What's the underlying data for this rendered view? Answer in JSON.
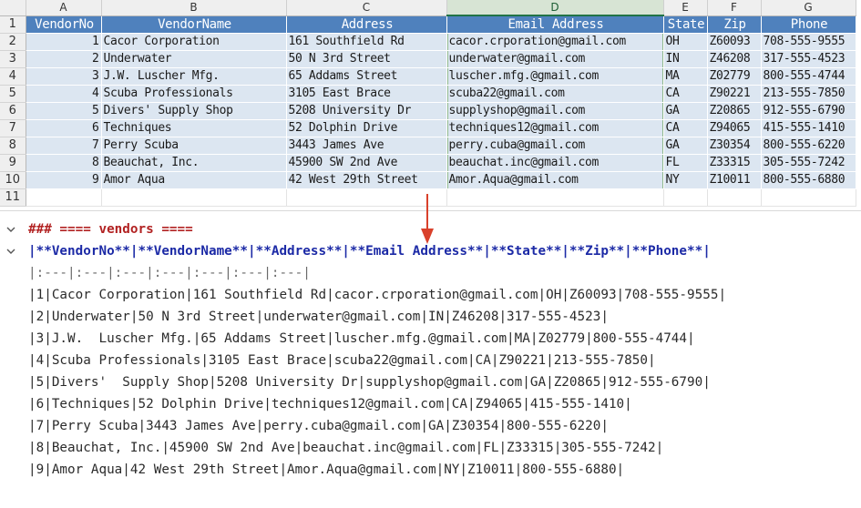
{
  "spreadsheet": {
    "column_letters": [
      "A",
      "B",
      "C",
      "D",
      "E",
      "F",
      "G"
    ],
    "row_numbers": [
      "1",
      "2",
      "3",
      "4",
      "5",
      "6",
      "7",
      "8",
      "9",
      "10",
      "11"
    ],
    "headers": [
      "VendorNo",
      "VendorName",
      "Address",
      "Email Address",
      "State",
      "Zip",
      "Phone"
    ],
    "rows": [
      [
        "1",
        "Cacor Corporation",
        "161 Southfield Rd",
        "cacor.crporation@gmail.com",
        "OH",
        "Z60093",
        "708-555-9555"
      ],
      [
        "2",
        "Underwater",
        "50 N 3rd Street",
        "underwater@gmail.com",
        "IN",
        "Z46208",
        "317-555-4523"
      ],
      [
        "3",
        "J.W.  Luscher Mfg.",
        "65 Addams Street",
        "luscher.mfg.@gmail.com",
        "MA",
        "Z02779",
        "800-555-4744"
      ],
      [
        "4",
        "Scuba Professionals",
        "3105 East Brace",
        "scuba22@gmail.com",
        "CA",
        "Z90221",
        "213-555-7850"
      ],
      [
        "5",
        "Divers'  Supply Shop",
        "5208 University Dr",
        "supplyshop@gmail.com",
        "GA",
        "Z20865",
        "912-555-6790"
      ],
      [
        "6",
        "Techniques",
        "52 Dolphin Drive",
        "techniques12@gmail.com",
        "CA",
        "Z94065",
        "415-555-1410"
      ],
      [
        "7",
        "Perry Scuba",
        "3443 James Ave",
        "perry.cuba@gmail.com",
        "GA",
        "Z30354",
        "800-555-6220"
      ],
      [
        "8",
        "Beauchat, Inc.",
        "45900 SW 2nd Ave",
        "beauchat.inc@gmail.com",
        "FL",
        "Z33315",
        "305-555-7242"
      ],
      [
        "9",
        "Amor Aqua",
        "42 West 29th Street",
        "Amor.Aqua@gmail.com",
        "NY",
        "Z10011",
        "800-555-6880"
      ]
    ],
    "selected_column": "D"
  },
  "markdown": {
    "heading": "### ==== vendors ====",
    "table_header": "|**VendorNo**|**VendorName**|**Address**|**Email Address**|**State**|**Zip**|**Phone**|",
    "separator": "|:---|:---|:---|:---|:---|:---|:---|",
    "rows": [
      "|1|Cacor Corporation|161 Southfield Rd|cacor.crporation@gmail.com|OH|Z60093|708-555-9555|",
      "|2|Underwater|50 N 3rd Street|underwater@gmail.com|IN|Z46208|317-555-4523|",
      "|3|J.W.  Luscher Mfg.|65 Addams Street|luscher.mfg.@gmail.com|MA|Z02779|800-555-4744|",
      "|4|Scuba Professionals|3105 East Brace|scuba22@gmail.com|CA|Z90221|213-555-7850|",
      "|5|Divers'  Supply Shop|5208 University Dr|supplyshop@gmail.com|GA|Z20865|912-555-6790|",
      "|6|Techniques|52 Dolphin Drive|techniques12@gmail.com|CA|Z94065|415-555-1410|",
      "|7|Perry Scuba|3443 James Ave|perry.cuba@gmail.com|GA|Z30354|800-555-6220|",
      "|8|Beauchat, Inc.|45900 SW 2nd Ave|beauchat.inc@gmail.com|FL|Z33315|305-555-7242|",
      "|9|Amor Aqua|42 West 29th Street|Amor.Aqua@gmail.com|NY|Z10011|800-555-6880|"
    ]
  },
  "icons": {
    "fold_heading": "chevron-down-icon",
    "fold_table": "chevron-down-icon",
    "arrow": "arrow-down-icon"
  },
  "colors": {
    "header_fill": "#4f81bd",
    "band_fill": "#dce6f1",
    "heading_text": "#b22222",
    "table_header_text": "#1c2aa6",
    "arrow": "#d9412b"
  }
}
